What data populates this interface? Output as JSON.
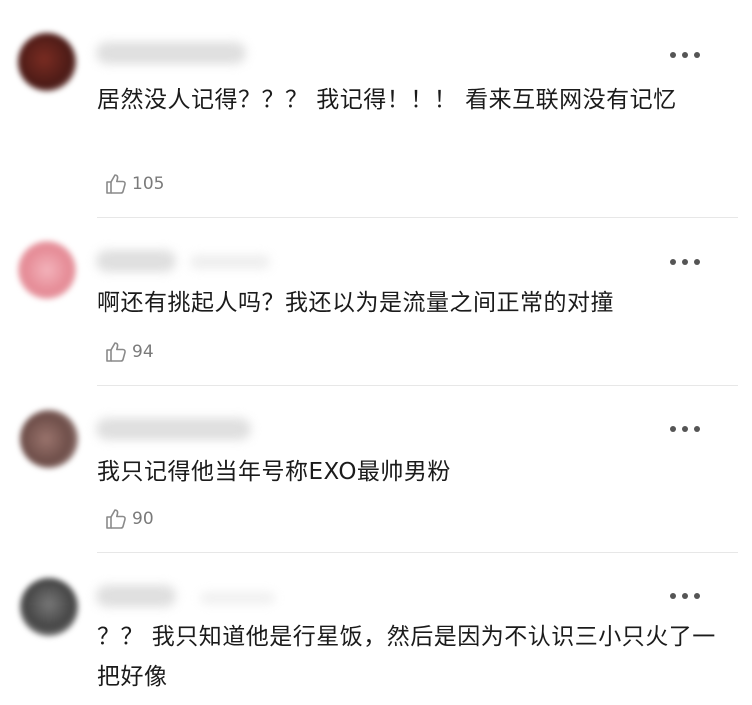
{
  "comments": [
    {
      "text": "居然没人记得？？？ 我记得！！！ 看来互联网没有记忆",
      "likes": "105",
      "avatar_color": "#6b2b22"
    },
    {
      "text": "啊还有挑起人吗？我还以为是流量之间正常的对撞",
      "likes": "94",
      "avatar_color": "#e58a95"
    },
    {
      "text": "我只记得他当年号称EXO最帅男粉",
      "likes": "90",
      "avatar_color": "#8a6a64"
    },
    {
      "text": "？？ 我只知道他是行星饭，然后是因为不认识三小只火了一把好像",
      "likes": "",
      "avatar_color": "#5a5a5a"
    }
  ],
  "icons": {
    "more": "more-options-icon",
    "like": "thumbs-up-icon"
  }
}
